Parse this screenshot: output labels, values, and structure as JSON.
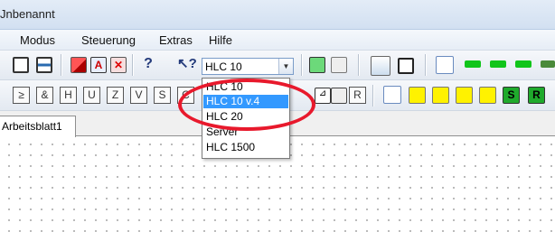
{
  "window": {
    "title": "Jnbenannt"
  },
  "menu": [
    {
      "label": "Modus"
    },
    {
      "label": "Steuerung"
    },
    {
      "label": "Extras"
    },
    {
      "label": "Hilfe"
    }
  ],
  "toolbar": {
    "device_select": {
      "value": "HLC 10",
      "options": [
        "HLC 10",
        "HLC 10 v.4",
        "HLC 20",
        "Server",
        "HLC 1500"
      ],
      "highlighted": "HLC 10 v.4"
    }
  },
  "logic_buttons": [
    {
      "label": "≥"
    },
    {
      "label": "&"
    },
    {
      "label": "H"
    },
    {
      "label": "U"
    },
    {
      "label": "Z"
    },
    {
      "label": "V"
    },
    {
      "label": "S"
    },
    {
      "label": "C"
    }
  ],
  "r_button": {
    "label": "R"
  },
  "s_block": {
    "label": "S"
  },
  "r_block": {
    "label": "R"
  },
  "tabs": [
    {
      "label": "Arbeitsblatt1"
    }
  ],
  "colors": {
    "highlight": "#3399ff",
    "annotation_circle": "#e8192c",
    "block_green": "#1faa2c"
  },
  "icons": [
    "display-icon",
    "monitor-icon",
    "red-cube-icon",
    "a-icon",
    "close-icon",
    "help-icon",
    "context-help-icon",
    "chip-icon",
    "network-icon",
    "pencil-icon",
    "graph-icon",
    "indicator-icons"
  ]
}
